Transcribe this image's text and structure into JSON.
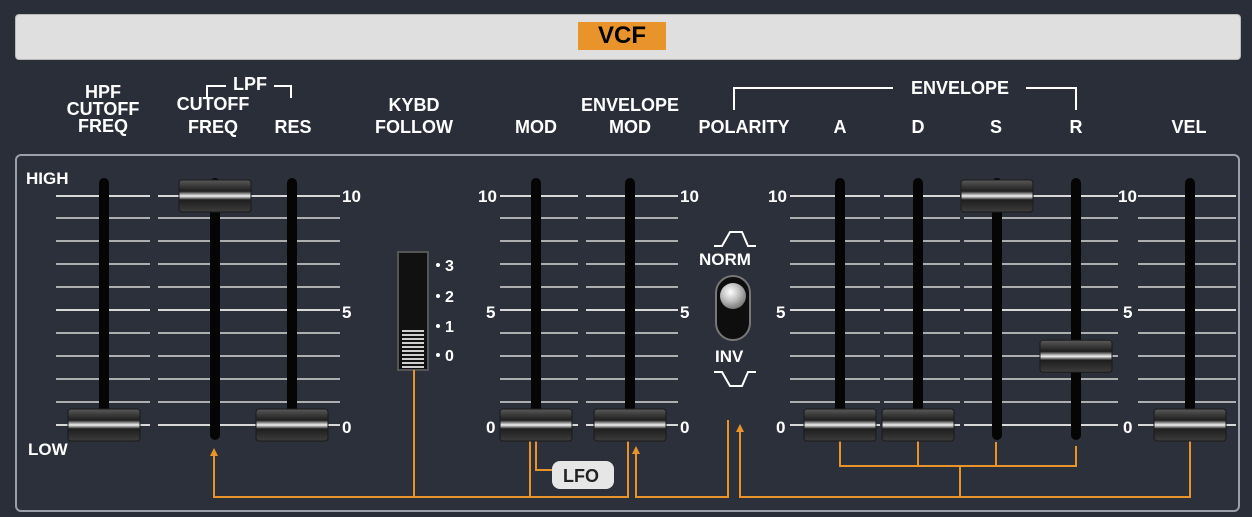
{
  "module": {
    "title": "VCF"
  },
  "labels": {
    "hpf_line1": "HPF",
    "hpf_line2": "CUTOFF",
    "hpf_line3": "FREQ",
    "lpf_group": "LPF",
    "lpf_cutoff_line1": "CUTOFF",
    "lpf_cutoff_line2": "FREQ",
    "res": "RES",
    "kybd_line1": "KYBD",
    "kybd_line2": "FOLLOW",
    "mod": "MOD",
    "envmod_line1": "ENVELOPE",
    "envmod_line2": "MOD",
    "envelope_group": "ENVELOPE",
    "polarity": "POLARITY",
    "a": "A",
    "d": "D",
    "s": "S",
    "r": "R",
    "vel": "VEL"
  },
  "scale": {
    "high": "HIGH",
    "low": "LOW",
    "ten": "10",
    "five": "5",
    "zero": "0"
  },
  "kybd_switch": {
    "positions": [
      "3",
      "2",
      "1",
      "0"
    ],
    "selected": "0"
  },
  "polarity_switch": {
    "norm": "NORM",
    "inv": "INV",
    "selected": "NORM"
  },
  "lfo_tag": "LFO",
  "sliders": {
    "hpf_cutoff": 0.0,
    "lpf_cutoff": 1.0,
    "res": 0.0,
    "mod": 0.0,
    "env_mod": 0.0,
    "env_a": 0.0,
    "env_d": 0.0,
    "env_s": 1.0,
    "env_r": 0.3,
    "vel": 0.0
  },
  "colors": {
    "accent": "#e8942a",
    "title_bar": "#dfdfdf",
    "panel_bg": "#2c303a"
  }
}
